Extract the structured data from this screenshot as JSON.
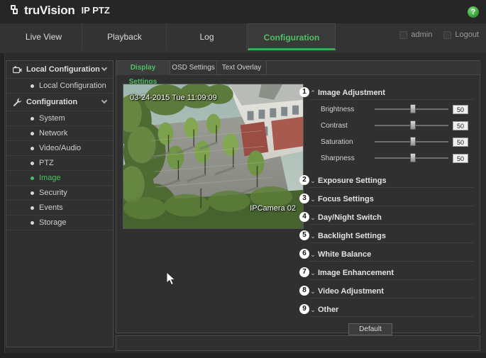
{
  "header": {
    "logo_text": "truVision",
    "logo_sub": "IP PTZ",
    "help_icon": "question-mark-icon",
    "help_label": "?"
  },
  "nav": {
    "tabs": [
      {
        "label": "Live View",
        "active": false
      },
      {
        "label": "Playback",
        "active": false
      },
      {
        "label": "Log",
        "active": false
      },
      {
        "label": "Configuration",
        "active": true
      }
    ],
    "user": "admin",
    "logout": "Logout"
  },
  "sidebar": {
    "groups": [
      {
        "label": "Local Configuration",
        "icon": "camera-icon",
        "expanded": true,
        "items": [
          {
            "label": "Local Configuration",
            "selected": false
          }
        ]
      },
      {
        "label": "Configuration",
        "icon": "wrench-icon",
        "expanded": true,
        "items": [
          {
            "label": "System",
            "selected": false
          },
          {
            "label": "Network",
            "selected": false
          },
          {
            "label": "Video/Audio",
            "selected": false
          },
          {
            "label": "PTZ",
            "selected": false
          },
          {
            "label": "Image",
            "selected": true
          },
          {
            "label": "Security",
            "selected": false
          },
          {
            "label": "Events",
            "selected": false
          },
          {
            "label": "Storage",
            "selected": false
          }
        ]
      }
    ]
  },
  "content": {
    "subtabs": [
      {
        "label": "Display Settings",
        "active": true
      },
      {
        "label": "OSD Settings",
        "active": false
      },
      {
        "label": "Text Overlay",
        "active": false
      }
    ],
    "video": {
      "timestamp": "03-24-2015 Tue 11:09:09",
      "camera_name": "IPCamera 02"
    },
    "sections": [
      {
        "number": "1",
        "title": "Image Adjustment",
        "caret": "⌃",
        "expanded": true
      },
      {
        "number": "2",
        "title": "Exposure Settings",
        "caret": "⌄",
        "expanded": false
      },
      {
        "number": "3",
        "title": "Focus Settings",
        "caret": "⌄",
        "expanded": false
      },
      {
        "number": "4",
        "title": "Day/Night Switch",
        "caret": "⌄",
        "expanded": false
      },
      {
        "number": "5",
        "title": "Backlight Settings",
        "caret": "⌄",
        "expanded": false
      },
      {
        "number": "6",
        "title": "White Balance",
        "caret": "⌄",
        "expanded": false
      },
      {
        "number": "7",
        "title": "Image Enhancement",
        "caret": "⌄",
        "expanded": false
      },
      {
        "number": "8",
        "title": "Video Adjustment",
        "caret": "⌄",
        "expanded": false
      },
      {
        "number": "9",
        "title": "Other",
        "caret": "⌄",
        "expanded": false
      }
    ],
    "sliders": [
      {
        "label": "Brightness",
        "value": "50",
        "percent": 50
      },
      {
        "label": "Contrast",
        "value": "50",
        "percent": 50
      },
      {
        "label": "Saturation",
        "value": "50",
        "percent": 50
      },
      {
        "label": "Sharpness",
        "value": "50",
        "percent": 50
      }
    ],
    "default_button": "Default"
  },
  "colors": {
    "accent_green": "#4fbf63",
    "panel_bg": "#303030",
    "page_bg": "#2b2b2b"
  }
}
